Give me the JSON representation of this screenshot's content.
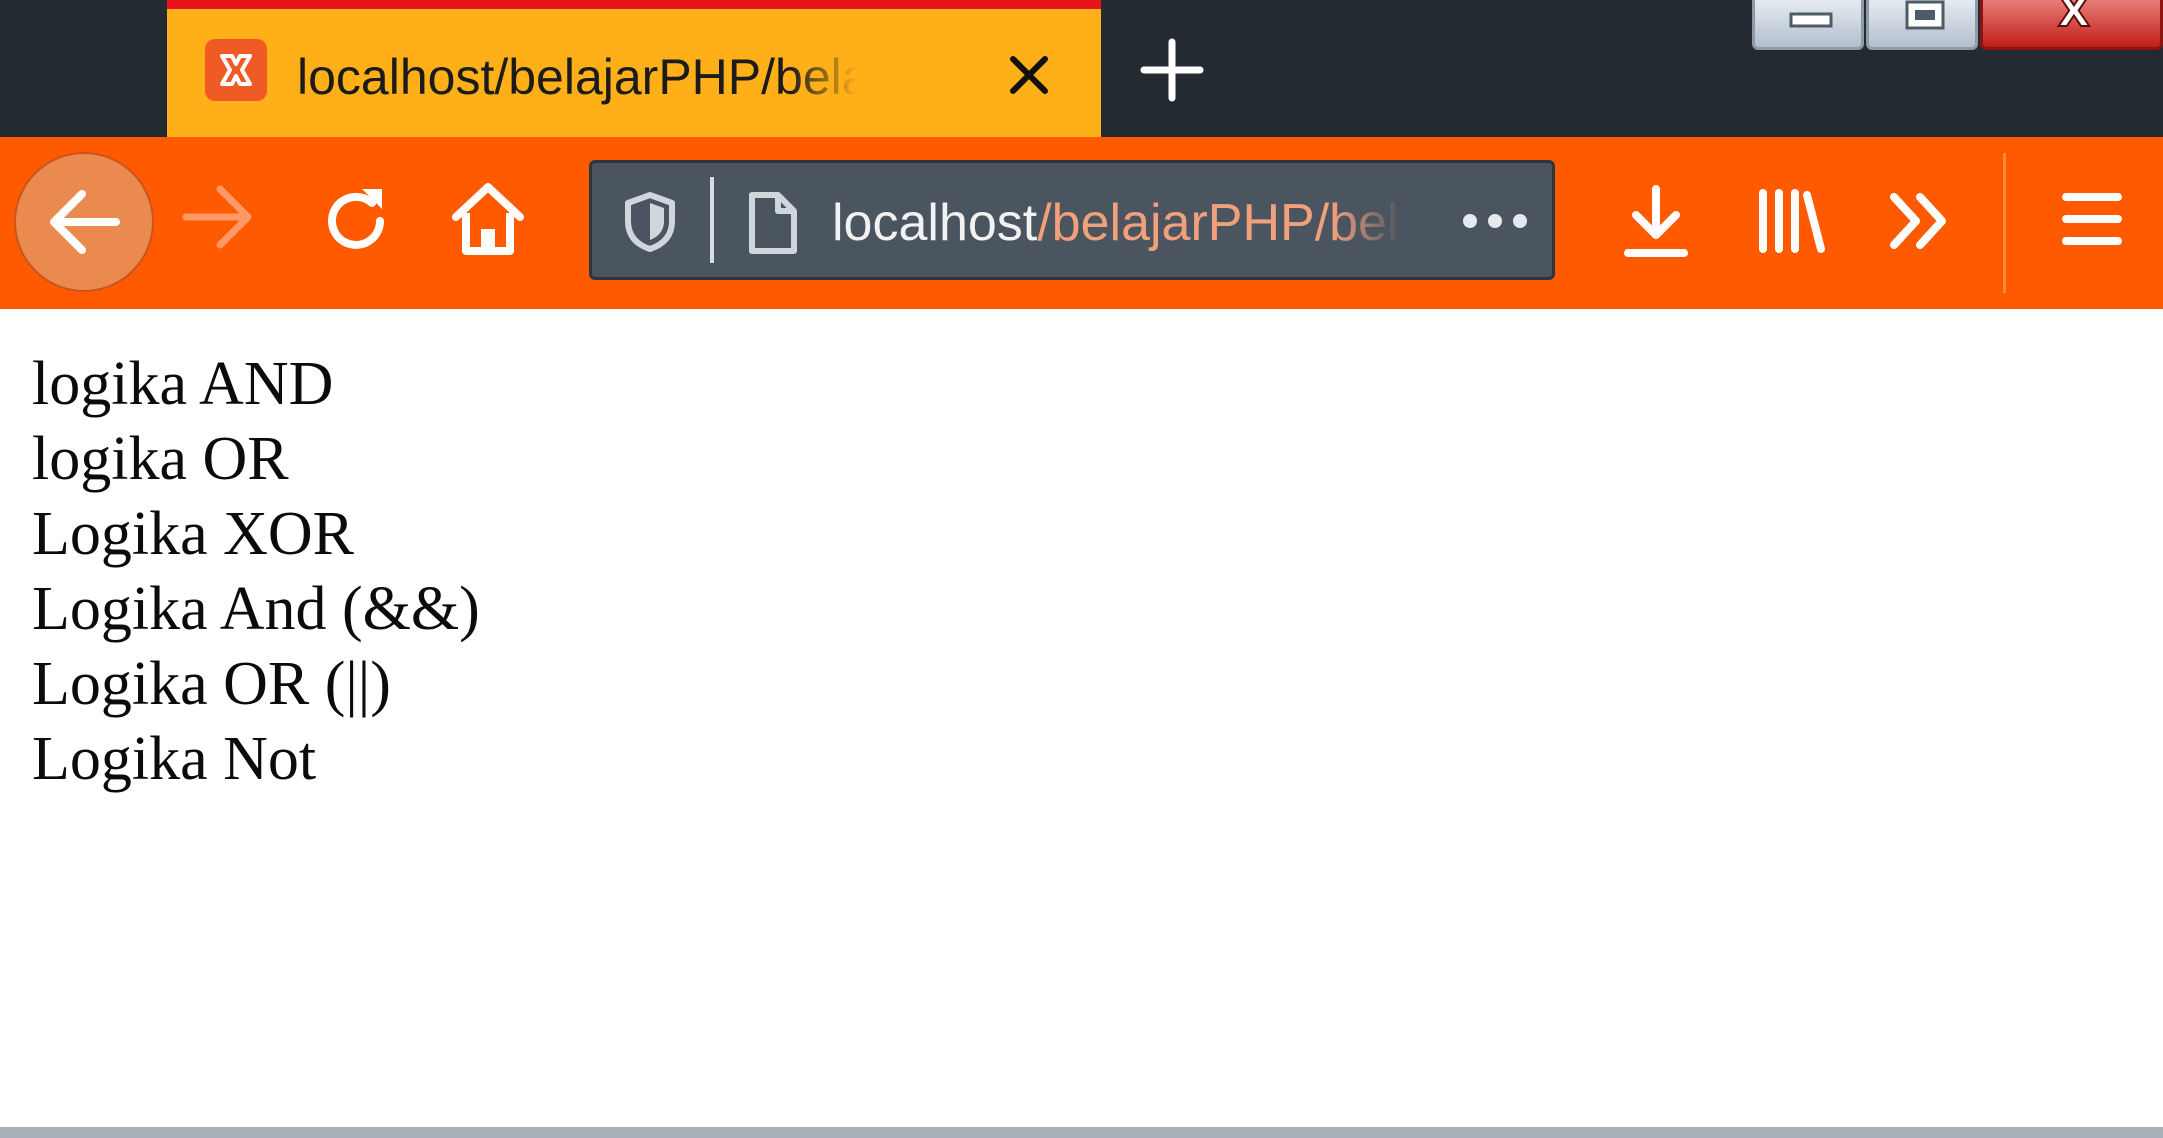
{
  "tab": {
    "title": "localhost/belajarPHP/belajar.php",
    "favicon": "xampp-icon",
    "active_color": "#ffb018"
  },
  "toolbar": {
    "back": "back-arrow-icon",
    "forward": "forward-arrow-icon",
    "reload": "reload-icon",
    "home": "home-icon",
    "download": "download-icon",
    "library": "library-icon",
    "overflow": "chevrons-right-icon",
    "menu": "hamburger-menu-icon",
    "accent_color": "#ff5a00"
  },
  "urlbar": {
    "host": "localhost",
    "path": "/belajarPHP/belajar.php",
    "more": "•••"
  },
  "window": {
    "close": "X"
  },
  "content": {
    "lines": [
      "logika AND",
      "logika OR",
      "Logika XOR",
      "Logika And (&&)",
      "Logika OR (||)",
      "Logika Not"
    ]
  }
}
